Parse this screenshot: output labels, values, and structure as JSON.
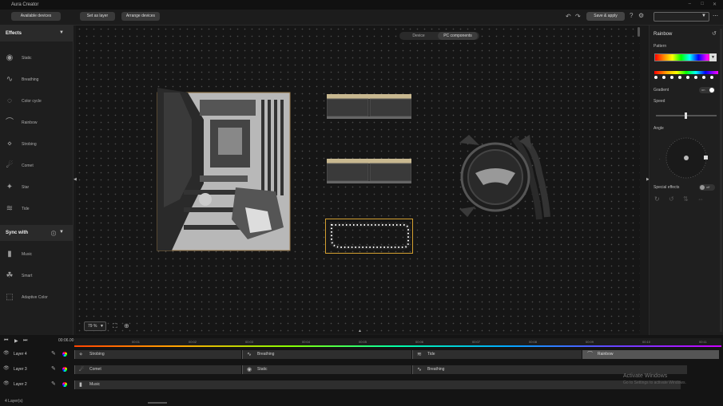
{
  "app": {
    "title": "Aura Creator"
  },
  "toolbar": {
    "available_devices": "Available devices",
    "set_as_layer": "Set as layer",
    "arrange_devices": "Arrange devices",
    "save_apply": "Save & apply"
  },
  "left": {
    "effects_header": "Effects",
    "effects": [
      {
        "label": "Static",
        "icon": "static-icon"
      },
      {
        "label": "Breathing",
        "icon": "breathing-icon"
      },
      {
        "label": "Color cycle",
        "icon": "color-cycle-icon"
      },
      {
        "label": "Rainbow",
        "icon": "rainbow-icon"
      },
      {
        "label": "Strobing",
        "icon": "strobing-icon"
      },
      {
        "label": "Comet",
        "icon": "comet-icon"
      },
      {
        "label": "Star",
        "icon": "star-icon"
      },
      {
        "label": "Tide",
        "icon": "tide-icon"
      }
    ],
    "sync_header": "Sync with",
    "sync": [
      {
        "label": "Music",
        "icon": "music-icon"
      },
      {
        "label": "Smart",
        "icon": "smart-icon"
      },
      {
        "label": "Adaptive Color",
        "icon": "adaptive-color-icon"
      }
    ]
  },
  "canvas": {
    "tabs": [
      "Device",
      "PC components"
    ],
    "active_tab": "PC components",
    "zoom": "79 %"
  },
  "right": {
    "title": "Rainbow",
    "pattern_label": "Pattern",
    "gradient_label": "Gradient",
    "gradient_state": "on",
    "speed_label": "Speed",
    "angle_label": "Angle",
    "special_label": "Special effects",
    "special_state": "off"
  },
  "timeline": {
    "time": "00:06.00",
    "ticks": [
      "00:01",
      "00:02",
      "00:03",
      "00:04",
      "00:05",
      "00:06",
      "00:07",
      "00:08",
      "00:09",
      "00:10",
      "00:11"
    ],
    "layers": [
      {
        "name": "Layer 4",
        "clips": [
          {
            "label": "Strobing",
            "icon": "strobing-icon"
          },
          {
            "label": "Breathing",
            "icon": "breathing-icon"
          },
          {
            "label": "Tide",
            "icon": "tide-icon"
          },
          {
            "label": "Rainbow",
            "icon": "rainbow-icon"
          }
        ]
      },
      {
        "name": "Layer 3",
        "clips": [
          {
            "label": "Comet",
            "icon": "comet-icon"
          },
          {
            "label": "Static",
            "icon": "static-icon"
          },
          {
            "label": "Breathing",
            "icon": "breathing-icon"
          }
        ]
      },
      {
        "name": "Layer 2",
        "clips": [
          {
            "label": "Music",
            "icon": "music-icon"
          }
        ]
      }
    ],
    "layer_count": "4 Layer(s)",
    "watermark_title": "Activate Windows",
    "watermark_sub": "Go to Settings to activate Windows."
  },
  "colors": {
    "accent": "#c8a050",
    "selection": "#d4a030"
  }
}
